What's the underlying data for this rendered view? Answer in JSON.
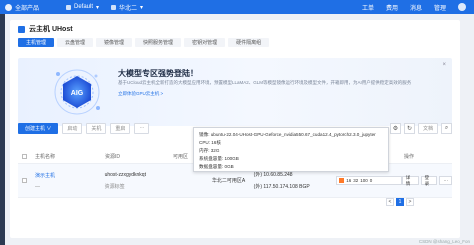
{
  "topbar": {
    "brand": "全部产品",
    "project": "Default",
    "region": "华北二",
    "menu": [
      "工单",
      "费用",
      "消息",
      "管理"
    ]
  },
  "page": {
    "title": "云主机 UHost"
  },
  "tabs": [
    "主机管理",
    "云盘管理",
    "镜像管理",
    "快照服务管理",
    "密钥对管理",
    "硬件隔离组"
  ],
  "banner": {
    "title": "大模型专区强势登陆！",
    "desc": "基于UCloud云主机全新打造的大模型应用环境，预置模型LLaMA2、GLM等模型镜像运行环境及模型文件，开箱即用，为AI用户提供稳定高效的服务",
    "link": "立即体验GPU云主机 >",
    "ai_label": "AIG"
  },
  "toolbar": {
    "create": "创建主机 ∨",
    "start": "启动",
    "stop": "关机",
    "restart": "重启",
    "more": "···",
    "doc": "文档",
    "search_placeholder": "搜索"
  },
  "table": {
    "headers": [
      "主机名称",
      "资源ID",
      "可用区",
      "",
      "",
      "",
      "操作"
    ],
    "row": {
      "name": "演示主机",
      "name_sub": "—",
      "id": "uhost-zzxgydknkqt",
      "id_sub": "资源标签",
      "zone": "华北二可用区A",
      "ip1": "(外) 10.60.85.248",
      "ip2": "(外) 117.50.174.108 BGP",
      "spec": "16",
      "spec2": "32",
      "spec3": "100",
      "spec4": "0",
      "ops": [
        "详情",
        "登录",
        "···"
      ]
    }
  },
  "tooltip": {
    "lines": [
      "镜像: ubuntu-22.04-UHost-GPU-Geforce_nvidia550.67_cuda12.4_pytorch2.3.0_jupyter",
      "CPU: 16核",
      "内存: 32G",
      "系统盘容量: 100GB",
      "数据盘容量: 0GB"
    ]
  },
  "pager": {
    "pages": [
      "<",
      "1",
      ">"
    ]
  },
  "watermark": "CSDN @shang_Leo_Fon"
}
